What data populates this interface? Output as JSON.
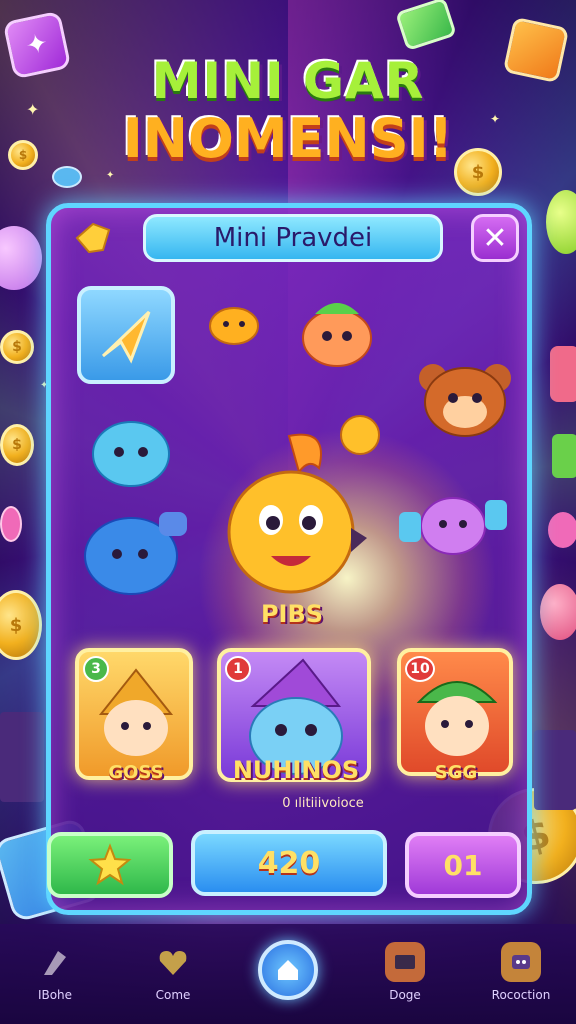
{
  "title": {
    "line1": "MINI GAR",
    "line2": "INOMENSI!"
  },
  "panel": {
    "header_title": "Mini Pravdei",
    "close_glyph": "✕"
  },
  "hero": {
    "label": "PIBS"
  },
  "cards": [
    {
      "badge": "3",
      "label": "GOSS",
      "badge_color": "#4ab84a"
    },
    {
      "badge": "1",
      "label": "NUHINOS",
      "badge_color": "#e03a3a"
    },
    {
      "badge": "10",
      "label": "SGG",
      "badge_color": "#e03a3a"
    }
  ],
  "subline": "0 ılitiiivoioce",
  "buttons": {
    "green_icon": "star-icon",
    "blue_value": "420",
    "purple_value": "01"
  },
  "nav": [
    {
      "label": "IBohe",
      "icon": "bolt-icon"
    },
    {
      "label": "Come",
      "icon": "heart-icon"
    },
    {
      "label": "",
      "icon": "home-icon"
    },
    {
      "label": "Doge",
      "icon": "inbox-icon"
    },
    {
      "label": "Rocoction",
      "icon": "robot-icon"
    }
  ],
  "colors": {
    "panel_border": "#5fd6ff",
    "title_green": "#a6f03a",
    "title_orange": "#ffb020",
    "gold": "#ffe066"
  }
}
